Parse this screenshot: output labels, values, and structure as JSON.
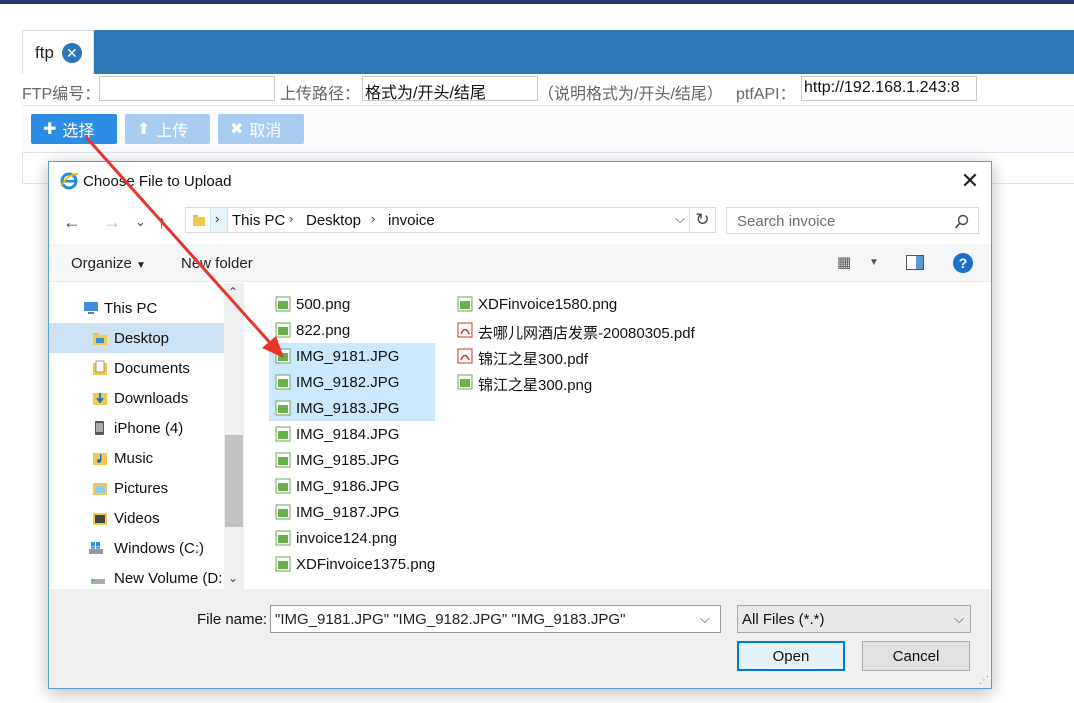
{
  "page": {
    "tab": {
      "label": "ftp",
      "close_icon": "close-circle-icon"
    },
    "form": {
      "ftp_no_label": "FTP编号：",
      "ftp_no_value": "",
      "upload_path_label": "上传路径：",
      "upload_path_value": "格式为/开头/结尾",
      "hint": "（说明格式为/开头/结尾）",
      "api_label": "ptfAPI：",
      "api_value": "http://192.168.1.243:8"
    },
    "buttons": {
      "select": "选择",
      "upload": "上传",
      "cancel": "取消"
    }
  },
  "dialog": {
    "title": "Choose File to Upload",
    "breadcrumb": [
      "This PC",
      "Desktop",
      "invoice"
    ],
    "search_placeholder": "Search invoice",
    "toolbar": {
      "organize": "Organize",
      "new_folder": "New folder"
    },
    "nav_items": [
      {
        "label": "This PC",
        "icon": "computer-icon",
        "selected": false
      },
      {
        "label": "Desktop",
        "icon": "folder-icon",
        "selected": true
      },
      {
        "label": "Documents",
        "icon": "documents-icon",
        "selected": false
      },
      {
        "label": "Downloads",
        "icon": "downloads-icon",
        "selected": false
      },
      {
        "label": "iPhone (4)",
        "icon": "phone-icon",
        "selected": false
      },
      {
        "label": "Music",
        "icon": "music-icon",
        "selected": false
      },
      {
        "label": "Pictures",
        "icon": "pictures-icon",
        "selected": false
      },
      {
        "label": "Videos",
        "icon": "videos-icon",
        "selected": false
      },
      {
        "label": "Windows (C:)",
        "icon": "drive-icon",
        "selected": false
      },
      {
        "label": "New Volume (D:",
        "icon": "drive-icon",
        "selected": false
      }
    ],
    "files_col1": [
      {
        "name": "500.png",
        "type": "image",
        "selected": false
      },
      {
        "name": "822.png",
        "type": "image",
        "selected": false
      },
      {
        "name": "IMG_9181.JPG",
        "type": "image",
        "selected": true
      },
      {
        "name": "IMG_9182.JPG",
        "type": "image",
        "selected": true
      },
      {
        "name": "IMG_9183.JPG",
        "type": "image",
        "selected": true
      },
      {
        "name": "IMG_9184.JPG",
        "type": "image",
        "selected": false
      },
      {
        "name": "IMG_9185.JPG",
        "type": "image",
        "selected": false
      },
      {
        "name": "IMG_9186.JPG",
        "type": "image",
        "selected": false
      },
      {
        "name": "IMG_9187.JPG",
        "type": "image",
        "selected": false
      },
      {
        "name": "invoice124.png",
        "type": "image",
        "selected": false
      },
      {
        "name": "XDFinvoice1375.png",
        "type": "image",
        "selected": false
      }
    ],
    "files_col2": [
      {
        "name": "XDFinvoice1580.png",
        "type": "image",
        "selected": false
      },
      {
        "name": "去哪儿网酒店发票-20080305.pdf",
        "type": "pdf",
        "selected": false
      },
      {
        "name": "锦江之星300.pdf",
        "type": "pdf",
        "selected": false
      },
      {
        "name": "锦江之星300.png",
        "type": "image",
        "selected": false
      }
    ],
    "file_name_label": "File name:",
    "file_name_value": "\"IMG_9181.JPG\" \"IMG_9182.JPG\" \"IMG_9183.JPG\"",
    "filter_value": "All Files (*.*)",
    "open_label": "Open",
    "cancel_label": "Cancel"
  },
  "colors": {
    "page_blue": "#2e77b7",
    "primary_button": "#2d8ce3",
    "disabled_button": "#a9cdf0",
    "selection": "#cce8ff",
    "annotation_arrow": "#e8352b"
  }
}
